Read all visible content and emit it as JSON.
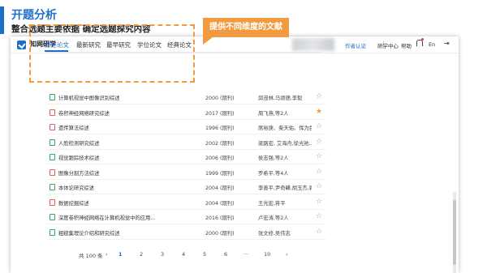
{
  "slide": {
    "title": "开题分析",
    "subtitle": "整合选题主要依据 确定选题探究内容"
  },
  "header": {
    "logo_text": "知网研学",
    "links": [
      "作者认证",
      "研学中心",
      "帮助",
      "En"
    ]
  },
  "callout": "提供不同维度的文献",
  "tabs": [
    "综述论文",
    "最新研究",
    "最早研究",
    "学位论文",
    "经典论文"
  ],
  "table": {
    "rows": [
      {
        "title": "计算机视觉中图像识别综述",
        "date": "2000 (期刊)",
        "authors": "邱茂林,马颂德,李毅",
        "starred": false,
        "type": "doc"
      },
      {
        "title": "卷积神经网络研究综述",
        "date": "2017 (期刊)",
        "authors": "周飞燕,等2人",
        "starred": true,
        "type": "pdf"
      },
      {
        "title": "遗传算法综述",
        "date": "1996 (期刊)",
        "authors": "席裕庚、柴天佑、恽为民",
        "starred": false,
        "type": "pdf"
      },
      {
        "title": "人脸检测研究综述",
        "date": "2002 (期刊)",
        "authors": "梁路宏, 艾海舟,徐光祐...",
        "starred": false,
        "type": "doc"
      },
      {
        "title": "视觉跟踪技术综述",
        "date": "2006 (期刊)",
        "authors": "侯志强,等2人",
        "starred": false,
        "type": "doc"
      },
      {
        "title": "图像分割方法综述",
        "date": "1999 (期刊)",
        "authors": "罗希平,等4人",
        "starred": false,
        "type": "pdf"
      },
      {
        "title": "本体论研究综述",
        "date": "2004 (期刊)",
        "authors": "李善平,尹奇韡,胡玉杰,郭...",
        "starred": false,
        "type": "doc"
      },
      {
        "title": "数据挖掘综述",
        "date": "2004 (期刊)",
        "authors": "王光宏,蒋平",
        "starred": false,
        "type": "pdf"
      },
      {
        "title": "深度卷积神经网络在计算机视觉中的应用...",
        "date": "2016 (期刊)",
        "authors": "卢宏涛,等2人",
        "starred": false,
        "type": "doc"
      },
      {
        "title": "粗糙集理论介绍和研究综述",
        "date": "2000 (期刊)",
        "authors": "张文修,吴伟志",
        "starred": false,
        "type": "doc"
      }
    ]
  },
  "pagination": {
    "total": "共 100 条",
    "prev": "‹",
    "pages": [
      "1",
      "2",
      "3",
      "4",
      "5",
      "6"
    ],
    "ellipsis": "···",
    "last": "10",
    "next": "›"
  },
  "icons": {
    "star_outline": "☆",
    "star_filled": "★",
    "exit": "⇥"
  },
  "colors": {
    "accent": "#1f6fc9",
    "highlight": "#f29a3f"
  }
}
